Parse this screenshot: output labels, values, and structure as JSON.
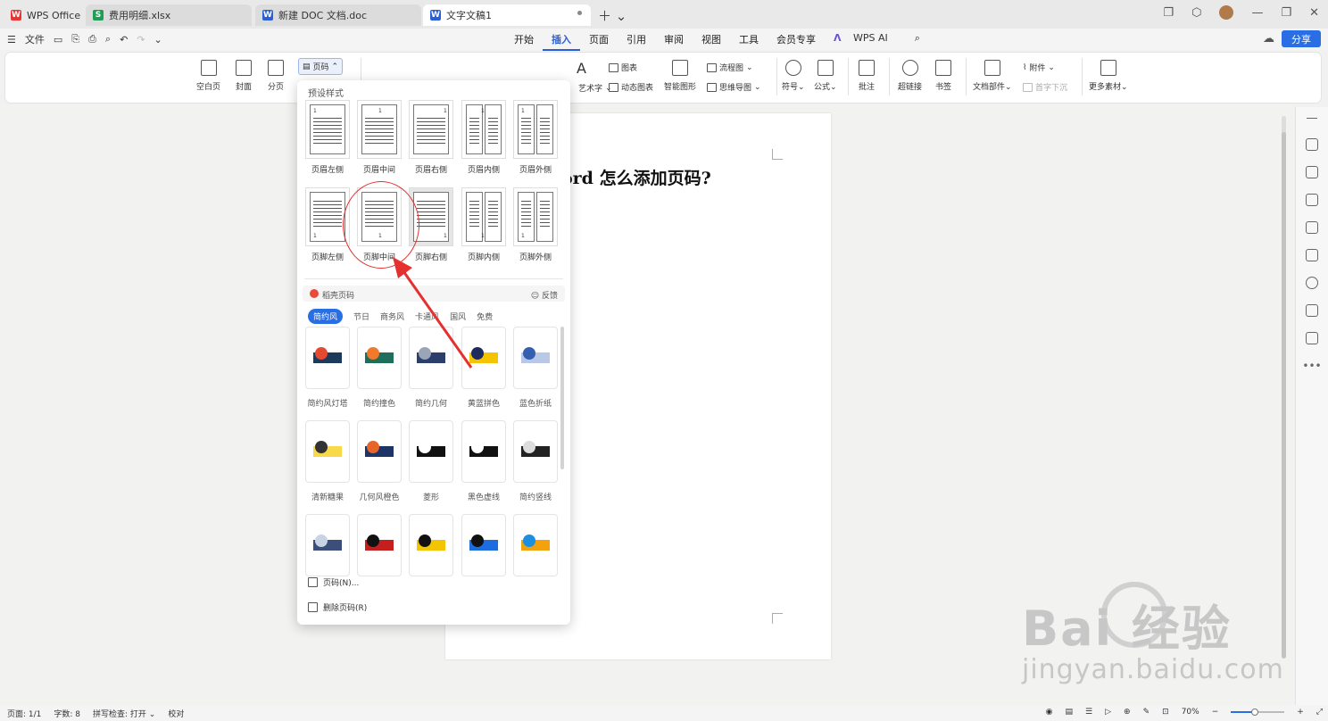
{
  "tabs": [
    {
      "label": "WPS Office",
      "icon": "wps-logo-icon",
      "color": "#e33"
    },
    {
      "label": "费用明细.xlsx",
      "icon": "sheet-icon",
      "color": "#1f9d55"
    },
    {
      "label": "新建 DOC 文档.doc",
      "icon": "writer-icon",
      "color": "#2a5fd6"
    },
    {
      "label": "文字文稿1",
      "icon": "writer-icon",
      "color": "#2a5fd6"
    }
  ],
  "menubar": {
    "file": "文件",
    "menus": [
      "开始",
      "插入",
      "页面",
      "引用",
      "审阅",
      "视图",
      "工具",
      "会员专享"
    ],
    "active_menu": "插入",
    "wps_ai": "WPS AI",
    "share": "分享"
  },
  "ribbon": {
    "blank_page": "空白页",
    "cover": "封面",
    "page_break": "分页",
    "page_number": "页码",
    "art_text": "艺术字",
    "chart": "图表",
    "dynamic_chart": "动态图表",
    "smart_shape": "智能图形",
    "flowchart": "流程图",
    "mindmap": "思维导图",
    "symbol": "符号",
    "formula": "公式",
    "comment": "批注",
    "hyperlink": "超链接",
    "bookmark": "书签",
    "doc_parts": "文档部件",
    "attachment": "附件",
    "drop_cap": "首字下沉",
    "more_material": "更多素材"
  },
  "document": {
    "title": "ord 怎么添加页码?"
  },
  "panel": {
    "preset_heading": "预设样式",
    "header_styles": [
      "页眉左侧",
      "页眉中间",
      "页眉右侧",
      "页眉内侧",
      "页眉外侧"
    ],
    "footer_styles": [
      "页脚左侧",
      "页脚中间",
      "页脚右侧",
      "页脚内侧",
      "页脚外侧"
    ],
    "shell_heading": "稻壳页码",
    "feedback": "反馈",
    "filters": [
      "简约风",
      "节日",
      "商务风",
      "卡通风",
      "国风",
      "免费"
    ],
    "active_filter": "简约风",
    "templates_row1": [
      "简约风灯塔",
      "简约撞色",
      "简约几何",
      "黄蓝拼色",
      "蓝色折纸"
    ],
    "templates_row2": [
      "清新糖果",
      "几何风橙色",
      "菱形",
      "黑色虚线",
      "简约竖线"
    ],
    "page_number_cmd": "页码(N)...",
    "delete_page_number_cmd": "删除页码(R)"
  },
  "status": {
    "page": "页面: 1/1",
    "words": "字数: 8",
    "spellcheck": "拼写检查: 打开",
    "proof": "校对",
    "zoom": "70%",
    "zoom_fraction": 0.45
  },
  "watermark": {
    "brand": "Bai  经验",
    "url": "jingyan.baidu.com"
  },
  "colors": {
    "accent": "#2a6ee6",
    "annotation": "#e53030"
  }
}
